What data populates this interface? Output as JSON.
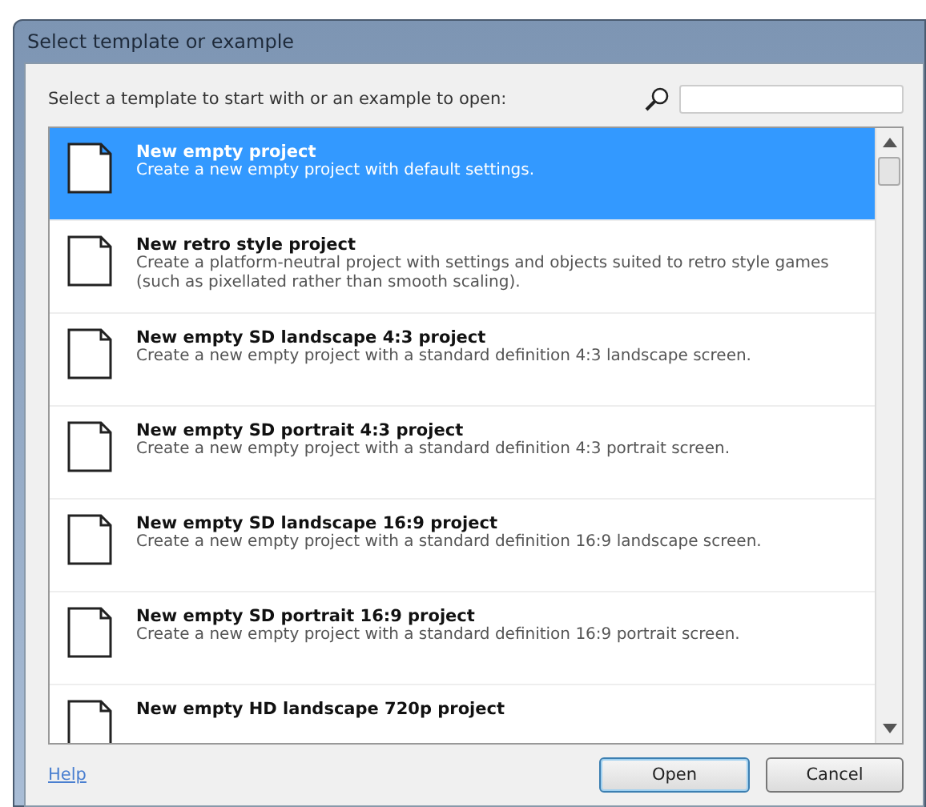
{
  "window": {
    "title": "Select template or example"
  },
  "prompt": "Select a template to start with or an example to open:",
  "templates": [
    {
      "title": "New empty project",
      "description": "Create a new empty project with default settings.",
      "selected": true
    },
    {
      "title": "New retro style project",
      "description": "Create a platform-neutral project with settings and objects suited to retro style games (such as pixellated rather than smooth scaling).",
      "selected": false
    },
    {
      "title": "New empty SD landscape 4:3 project",
      "description": "Create a new empty project with a standard definition 4:3 landscape screen.",
      "selected": false
    },
    {
      "title": "New empty SD portrait 4:3 project",
      "description": "Create a new empty project with a standard definition 4:3 portrait screen.",
      "selected": false
    },
    {
      "title": "New empty SD landscape 16:9 project",
      "description": "Create a new empty project with a standard definition 16:9 landscape screen.",
      "selected": false
    },
    {
      "title": "New empty SD portrait 16:9 project",
      "description": "Create a new empty project with a standard definition 16:9 portrait screen.",
      "selected": false
    },
    {
      "title": "New empty HD landscape 720p project",
      "selected": false
    }
  ],
  "help_link": "Help",
  "buttons": [
    {
      "label": "Open",
      "kind": "default"
    },
    {
      "label": "Cancel",
      "kind": "normal"
    }
  ]
}
